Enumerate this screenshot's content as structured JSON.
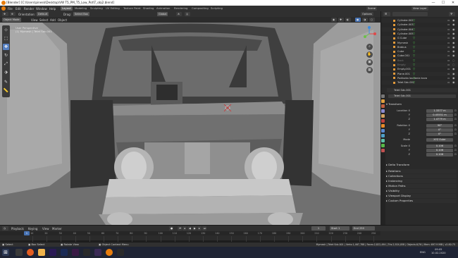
{
  "window": {
    "title": "[Blender] [C:\\Users\\pinesk\\Desktop\\VW T5_PM_T5_Low_Pot\\T_obj2.blend]",
    "controls": [
      "—",
      "☐",
      "✕"
    ]
  },
  "menubar": {
    "items": [
      "File",
      "Edit",
      "Render",
      "Window",
      "Help"
    ],
    "workspaces": [
      "Layout",
      "Modeling",
      "Sculpting",
      "UV Editing",
      "Texture Paint",
      "Shading",
      "Animation",
      "Rendering",
      "Compositing",
      "Scripting"
    ],
    "active_workspace": "Layout",
    "scene_label": "Scene",
    "view_layer_label": "View Layer"
  },
  "toolbar": {
    "orientation_label": "Orientation:",
    "orientation_value": "Default",
    "drag_label": "Drag:",
    "drag_value": "Select Box",
    "pivot_value": "Global",
    "options_label": "Options"
  },
  "viewport_header": {
    "mode": "Object Mode",
    "menus": [
      "View",
      "Select",
      "Add",
      "Object"
    ]
  },
  "viewport": {
    "info_line1": "User Perspective",
    "info_line2": "(1) Mymesh | Telet Sdc.001",
    "tools": [
      "cursor",
      "select",
      "move",
      "rotate",
      "scale",
      "transform",
      "annotate",
      "measure"
    ],
    "active_tool": "move"
  },
  "outliner": {
    "items": [
      {
        "name": "Cylinder.002",
        "visible": true
      },
      {
        "name": "Cylinder.003",
        "visible": true
      },
      {
        "name": "Cylinder.004",
        "visible": true
      },
      {
        "name": "Cylinder.005",
        "visible": true
      },
      {
        "name": "G Cube",
        "visible": true
      },
      {
        "name": "Mymesh",
        "visible": true
      },
      {
        "name": "Brabus",
        "visible": true
      },
      {
        "name": "Cube",
        "visible": true
      },
      {
        "name": "Cube.001",
        "visible": true
      },
      {
        "name": "Back",
        "visible": false
      },
      {
        "name": "Empty",
        "visible": false
      },
      {
        "name": "Empty.001",
        "visible": true
      },
      {
        "name": "Plane.001",
        "visible": true
      },
      {
        "name": "Podlozka loudania kova",
        "visible": true
      },
      {
        "name": "Telet Sdc.001",
        "visible": true
      }
    ]
  },
  "properties": {
    "object_name": "Telet Sdc.001",
    "object_field": "Telet Sdc.001",
    "transform_label": "Transform",
    "location_label": "Location X",
    "location": [
      "1.3377 m",
      "0.45551 m",
      "1.4779 m"
    ],
    "rotation_label": "Rotation X",
    "rotation": [
      "90°",
      "0°",
      "0°"
    ],
    "mode_label": "Mode",
    "mode_value": "XYZ Euler",
    "scale_label": "Scale X",
    "scale": [
      "0.106",
      "0.106",
      "0.106"
    ],
    "axis_labels": [
      "Y",
      "Z"
    ],
    "delta_transform": "Delta Transform",
    "closed_panels": [
      "Relations",
      "Collections",
      "Instancing",
      "Motion Paths",
      "Visibility",
      "Viewport Display",
      "Custom Properties"
    ]
  },
  "timeline": {
    "menus": [
      "Playback",
      "Keying",
      "View",
      "Marker"
    ],
    "current_frame": "1",
    "start_label": "Start",
    "start": "1",
    "end_label": "End",
    "end": "250",
    "ticks": [
      "10",
      "20",
      "30",
      "40",
      "50",
      "60",
      "70",
      "80",
      "90",
      "100",
      "110",
      "120",
      "130",
      "140",
      "150",
      "160",
      "170",
      "180",
      "190",
      "200",
      "210",
      "220",
      "230",
      "240",
      "250"
    ]
  },
  "statusbar": {
    "select": "Select",
    "box_select": "Box Select",
    "rotate_view": "Rotate View",
    "context_menu": "Object Context Menu",
    "stats": "Mymesh | Telet Sdc.001 | Verts:1,467,788 | Faces:2,822,494 | Tris:2,924,058 | Objects:0/76 | Mem: 697.9 MiB | v2.80.75"
  },
  "taskbar": {
    "time": "09:05",
    "date": "10.02.2020",
    "lang": "ENG"
  }
}
